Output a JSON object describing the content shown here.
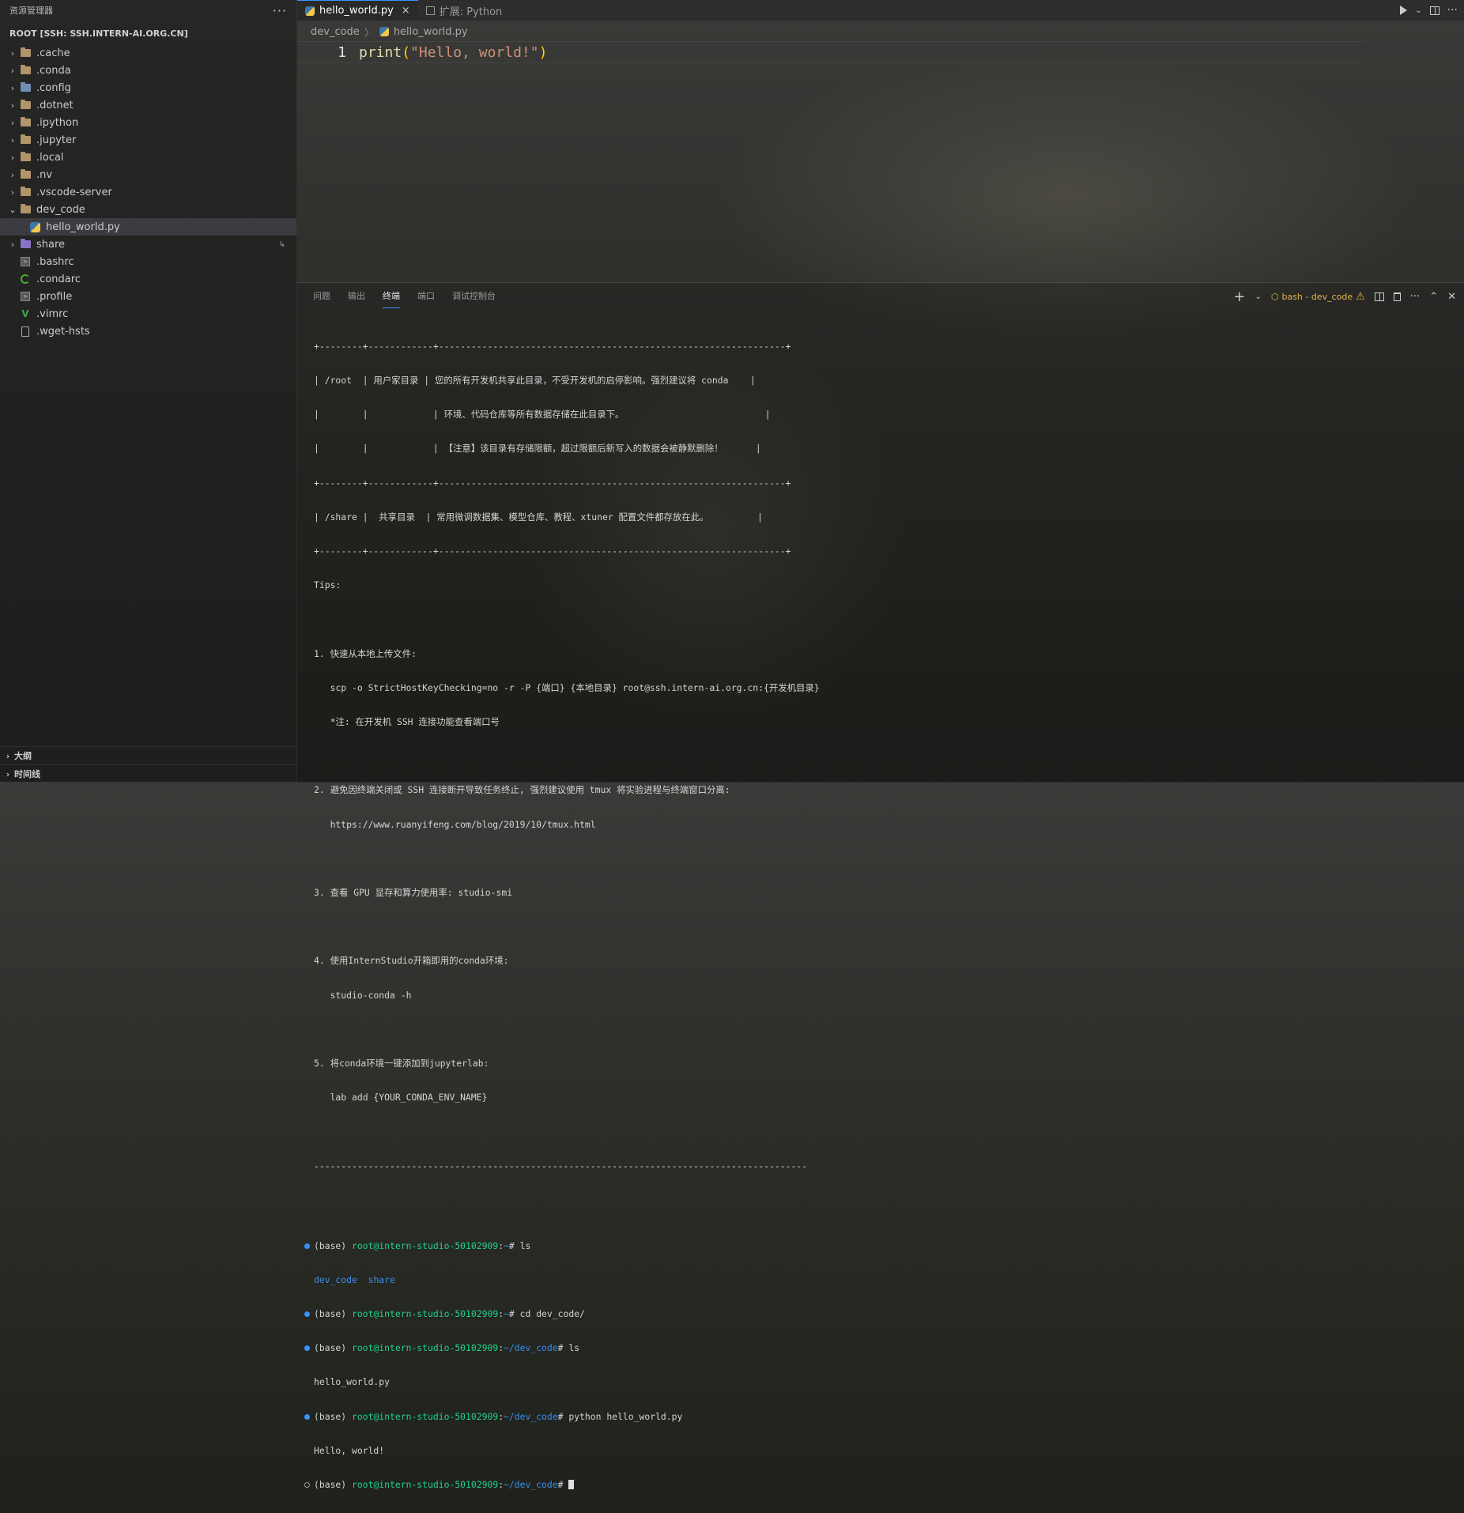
{
  "sidebar": {
    "title": "资源管理器",
    "more": "···",
    "root_label": "ROOT [SSH: SSH.INTERN-AI.ORG.CN]",
    "items": [
      {
        "label": ".cache"
      },
      {
        "label": ".conda"
      },
      {
        "label": ".config"
      },
      {
        "label": ".dotnet"
      },
      {
        "label": ".ipython"
      },
      {
        "label": ".jupyter"
      },
      {
        "label": ".local"
      },
      {
        "label": ".nv"
      },
      {
        "label": ".vscode-server"
      },
      {
        "label": "dev_code"
      },
      {
        "label": "hello_world.py"
      },
      {
        "label": "share"
      },
      {
        "label": ".bashrc"
      },
      {
        "label": ".condarc"
      },
      {
        "label": ".profile"
      },
      {
        "label": ".vimrc"
      },
      {
        "label": ".wget-hsts"
      }
    ],
    "share_badge": "↳",
    "outline_label": "大纲",
    "timeline_label": "时间线"
  },
  "tabs": [
    {
      "label": "hello_world.py",
      "close": "×"
    },
    {
      "label": "扩展: Python"
    }
  ],
  "breadcrumb": {
    "folder": "dev_code",
    "sep": "〉",
    "file": "hello_world.py"
  },
  "editor": {
    "line_number": "1",
    "code": {
      "fn": "print",
      "open": "(",
      "str": "\"Hello, world!\"",
      "close": ")"
    }
  },
  "panel": {
    "tabs": [
      "问题",
      "输出",
      "终端",
      "端口",
      "调试控制台"
    ],
    "active_tab": "终端",
    "terminal_name": "bash - dev_code",
    "terminal_lines": [
      "+--------+------------+----------------------------------------------------------------+",
      "| /root  | 用户家目录 | 您的所有开发机共享此目录，不受开发机的启停影响。强烈建议将 conda    |",
      "|        |            | 环境、代码仓库等所有数据存储在此目录下。                          |",
      "|        |            | 【注意】该目录有存储限额，超过限额后新写入的数据会被静默删除！      |",
      "+--------+------------+----------------------------------------------------------------+",
      "| /share |  共享目录  | 常用微调数据集、模型仓库、教程、xtuner 配置文件都存放在此。         |",
      "+--------+------------+----------------------------------------------------------------+",
      "Tips:",
      "",
      "1. 快速从本地上传文件:",
      "   scp -o StrictHostKeyChecking=no -r -P {端口} {本地目录} root@ssh.intern-ai.org.cn:{开发机目录}",
      "   *注: 在开发机 SSH 连接功能查看端口号",
      "",
      "2. 避免因终端关闭或 SSH 连接断开导致任务终止, 强烈建议使用 tmux 将实验进程与终端窗口分离:",
      "   https://www.ruanyifeng.com/blog/2019/10/tmux.html",
      "",
      "3. 查看 GPU 显存和算力使用率: studio-smi",
      "",
      "4. 使用InternStudio开箱即用的conda环境:",
      "   studio-conda -h",
      "",
      "5. 将conda环境一键添加到jupyterlab:",
      "   lab add {YOUR_CONDA_ENV_NAME}",
      "",
      "-------------------------------------------------------------------------------------------",
      ""
    ],
    "prompt": {
      "base": "(base) ",
      "user": "root@intern-studio-50102909",
      "sep": ":",
      "home": "~",
      "dir": "~/dev_code",
      "hash": "# "
    },
    "commands": {
      "c1": "ls",
      "o1a": "dev_code",
      "o1b": "share",
      "c2": "cd dev_code/",
      "c3": "ls",
      "o3": "hello_world.py",
      "c4": "python hello_world.py",
      "o4": "Hello, world!"
    }
  }
}
